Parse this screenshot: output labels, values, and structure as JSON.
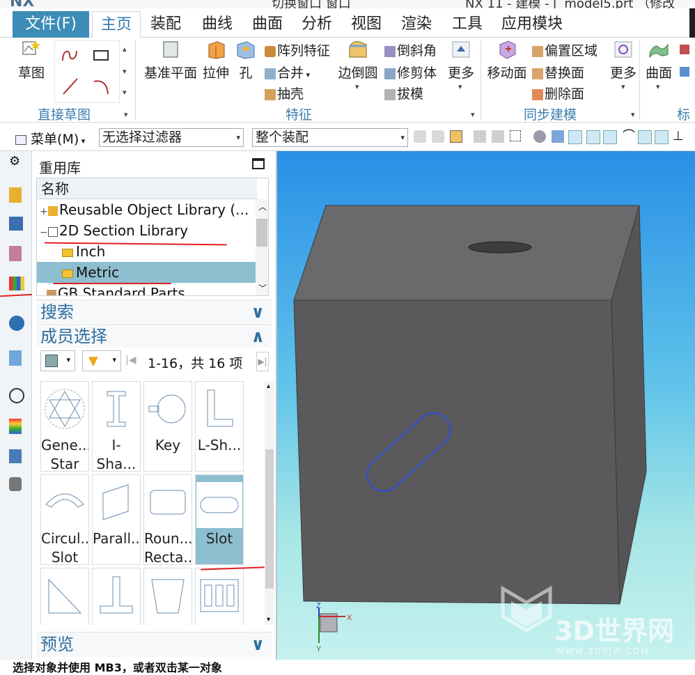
{
  "title_bar": {
    "app": "NX",
    "left_text": "切换窗口 窗口",
    "center_text": "NX 11 - 建模 - [_model5.prt （修改"
  },
  "menu": {
    "file": "文件(F)",
    "tabs": [
      "主页",
      "装配",
      "曲线",
      "曲面",
      "分析",
      "视图",
      "渲染",
      "工具",
      "应用模块"
    ]
  },
  "ribbon": {
    "direct_sketch": {
      "sketch": "草图",
      "group": "直接草图"
    },
    "feature": {
      "datum_plane": "基准平面",
      "extrude": "拉伸",
      "hole": "孔",
      "pattern": "阵列特征",
      "unite": "合并",
      "shell": "抽壳",
      "edge_blend": "边倒圆",
      "chamfer": "倒斜角",
      "trim_body": "修剪体",
      "draft": "拔模",
      "more": "更多",
      "group": "特征"
    },
    "sync": {
      "move_face": "移动面",
      "offset_region": "偏置区域",
      "replace_face": "替换面",
      "delete_face": "删除面",
      "more": "更多",
      "group": "同步建模"
    },
    "surface": "曲面",
    "standard_group": "标"
  },
  "toolbar2": {
    "menu": "菜单(M)",
    "filter": "无选择过滤器",
    "scope": "整个装配"
  },
  "panel": {
    "title": "重用库",
    "tree_header": "名称",
    "tree": [
      {
        "label": "Reusable Object Library (...",
        "expand": "+"
      },
      {
        "label": "2D Section Library",
        "expand": "−"
      },
      {
        "label": "Inch",
        "expand": ""
      },
      {
        "label": "Metric",
        "expand": ""
      },
      {
        "label": "GB Standard Parts",
        "expand": ""
      }
    ],
    "search": "搜索",
    "member_select": "成员选择",
    "count": "1-16，共 16 项",
    "members": [
      {
        "l1": "Gene...",
        "l2": "Star",
        "icon": "star-icon"
      },
      {
        "l1": "I-Sha...",
        "l2": "",
        "icon": "i-shape-icon"
      },
      {
        "l1": "Key",
        "l2": "",
        "icon": "key-icon"
      },
      {
        "l1": "L-Sh...",
        "l2": "",
        "icon": "l-shape-icon"
      },
      {
        "l1": "Circul...",
        "l2": "Slot",
        "icon": "circular-slot-icon"
      },
      {
        "l1": "Parall...",
        "l2": "",
        "icon": "parallelogram-icon"
      },
      {
        "l1": "Roun...",
        "l2": "Recta...",
        "icon": "rounded-rectangle-icon"
      },
      {
        "l1": "Slot",
        "l2": "",
        "icon": "slot-icon"
      },
      {
        "l1": "",
        "l2": "",
        "icon": "triangle-icon"
      },
      {
        "l1": "",
        "l2": "",
        "icon": "t-shape-icon"
      },
      {
        "l1": "",
        "l2": "",
        "icon": "trapezoid-icon"
      },
      {
        "l1": "",
        "l2": "",
        "icon": "triple-slot-icon"
      }
    ],
    "preview": "预览"
  },
  "viewport": {
    "axis_x": "X",
    "axis_y": "Y",
    "axis_z": "Z",
    "watermark": "3D世界网",
    "watermark_url": "WWW.3DSJW.COM"
  },
  "status": "选择对象并使用 MB3，或者双击某一对象",
  "colors": {
    "accent": "#3d8bb7",
    "selected": "#8dbfd0",
    "annotation": "#e02020",
    "block": "#5b5b5d"
  }
}
